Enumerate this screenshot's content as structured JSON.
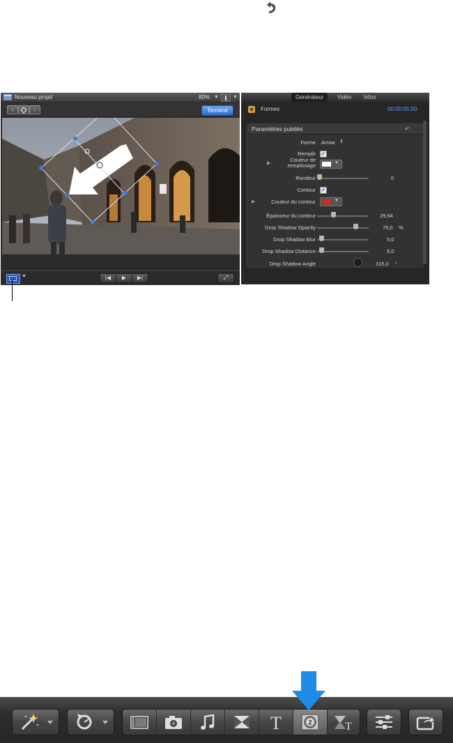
{
  "viewer": {
    "title": "Nouveau projet",
    "zoom": "80%",
    "done_label": "Terminé"
  },
  "inspector": {
    "tabs": [
      "Générateur",
      "Vidéo",
      "Infos"
    ],
    "generator_name": "Formes",
    "timecode": "00:00:05:00",
    "params_title": "Paramètres publiés",
    "params": {
      "forme_label": "Forme",
      "forme_value": "Arrow",
      "remplir_label": "Remplir",
      "fill_color_label_1": "Couleur de",
      "fill_color_label_2": "remplissage",
      "rondeur_label": "Rondeur",
      "rondeur_value": "0",
      "contour_label": "Contour",
      "contour_color_label": "Couleur du contour",
      "epaisseur_label": "Épaisseur du contour",
      "epaisseur_value": "29,94",
      "opacity_label": "Drop Shadow Opacity",
      "opacity_value": "75,0",
      "opacity_unit": "%",
      "blur_label": "Drop Shadow Blur",
      "blur_value": "5,0",
      "distance_label": "Drop Shadow Distance",
      "distance_value": "5,0",
      "angle_label": "Drop Shadow Angle",
      "angle_value": "315,0",
      "angle_unit": "°"
    },
    "fill_color": "#ffffff",
    "contour_color": "#d42a1a"
  },
  "toolbar": {
    "icons": [
      "magic-wand-icon",
      "retime-icon",
      "clip-browser-icon",
      "photo-browser-icon",
      "music-browser-icon",
      "transitions-browser-icon",
      "titles-browser-icon",
      "generators-browser-icon",
      "themes-browser-icon",
      "inspector-icon",
      "share-icon"
    ],
    "title_glyph": "T",
    "generator_badge": "2"
  },
  "colors": {
    "accent_blue": "#1f8be6",
    "done_button": "#2f6fd0"
  }
}
